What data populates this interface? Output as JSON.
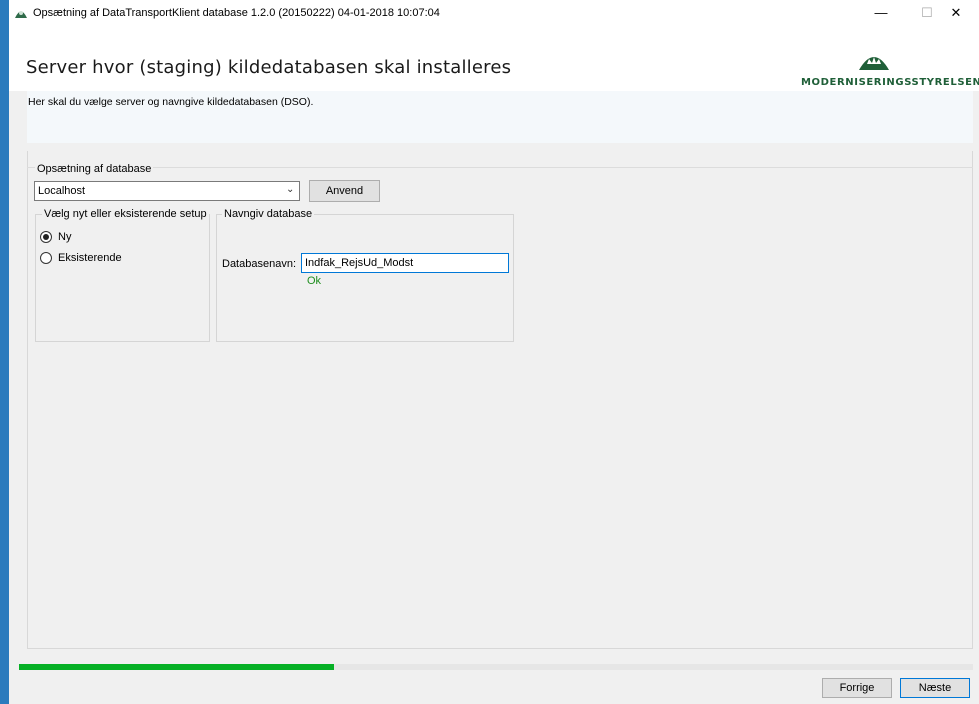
{
  "window": {
    "title": "Opsætning af DataTransportKlient database 1.2.0 (20150222) 04-01-2018 10:07:04",
    "minimize_glyph": "—",
    "maximize_glyph": "☐",
    "close_glyph": "✕"
  },
  "header": {
    "title": "Server hvor (staging) kildedatabasen skal installeres",
    "description": "Her skal du vælge server og navngive kildedatabasen (DSO).",
    "logo_text": "MODERNISERINGSSTYRELSEN",
    "logo_color": "#1f5f38"
  },
  "database_group": {
    "label": "Opsætning af database",
    "server_value": "Localhost",
    "apply_label": "Anvend"
  },
  "setup_group": {
    "label": "Vælg nyt eller eksisterende setup",
    "options": [
      {
        "label": "Ny",
        "selected": true
      },
      {
        "label": "Eksisterende",
        "selected": false
      }
    ]
  },
  "name_group": {
    "label": "Navngiv database",
    "field_label": "Databasenavn:",
    "field_value": "Indfak_RejsUd_Modst",
    "status": "Ok",
    "status_color": "#1e8e1e"
  },
  "progress": {
    "value": 0.33,
    "color": "#06b025"
  },
  "footer": {
    "back_label": "Forrige",
    "next_label": "Næste"
  }
}
